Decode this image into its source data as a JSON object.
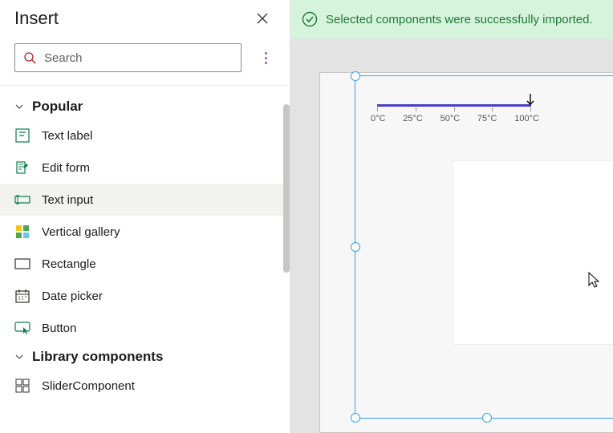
{
  "panel": {
    "title": "Insert",
    "search_placeholder": "Search"
  },
  "sections": {
    "popular": {
      "title": "Popular",
      "items": [
        {
          "label": "Text label"
        },
        {
          "label": "Edit form"
        },
        {
          "label": "Text input"
        },
        {
          "label": "Vertical gallery"
        },
        {
          "label": "Rectangle"
        },
        {
          "label": "Date picker"
        },
        {
          "label": "Button"
        }
      ]
    },
    "library": {
      "title": "Library components",
      "items": [
        {
          "label": "SliderComponent"
        }
      ]
    }
  },
  "banner": {
    "message": "Selected components were successfully imported."
  },
  "slider": {
    "ticks": [
      "0°C",
      "25°C",
      "50°C",
      "75°C",
      "100°C"
    ]
  },
  "colors": {
    "accent": "#8764b8",
    "selection": "#35a0f0",
    "success_bg": "#d6f3dc",
    "success_fg": "#1f7a3a",
    "slider": "#4b3cc4"
  }
}
